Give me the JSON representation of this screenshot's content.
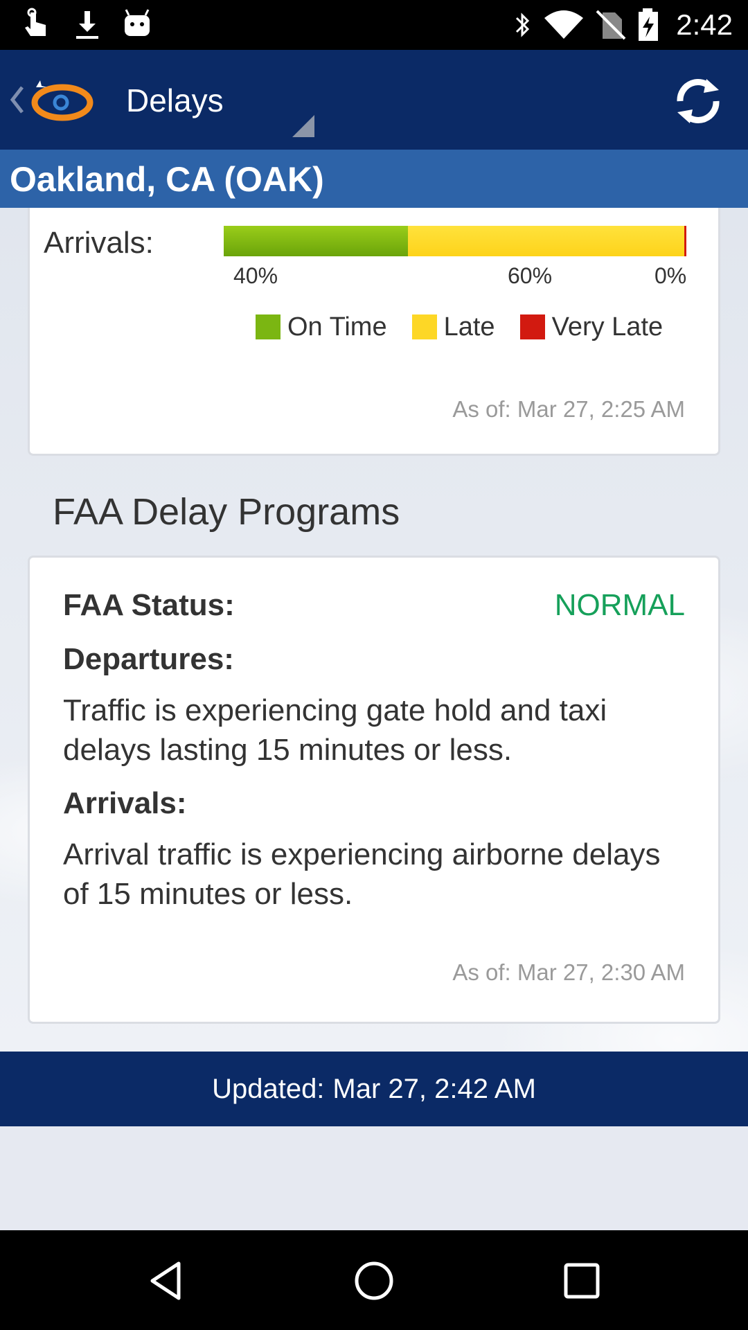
{
  "status_bar": {
    "time": "2:42",
    "left_icons": [
      "touch-icon",
      "download-icon",
      "android-icon"
    ],
    "right_icons": [
      "bluetooth-icon",
      "wifi-icon",
      "no-sim-icon",
      "battery-charging-icon"
    ]
  },
  "app_bar": {
    "title": "Delays",
    "logo": "flightview-logo",
    "refresh_icon": "refresh-icon"
  },
  "location": {
    "title": "Oakland, CA (OAK)"
  },
  "arrivals_card": {
    "label": "Arrivals:",
    "on_time_pct": 40,
    "late_pct": 60,
    "very_late_pct": 0,
    "pct_labels": [
      "40%",
      "60%",
      "0%"
    ],
    "legend": [
      "On Time",
      "Late",
      "Very Late"
    ],
    "colors": {
      "on_time": "#7bb612",
      "late": "#fdd726",
      "very_late": "#d21a10"
    },
    "as_of": "As of: Mar 27, 2:25 AM"
  },
  "faa": {
    "section_title": "FAA Delay Programs",
    "status_label": "FAA Status:",
    "status_value": "NORMAL",
    "status_color": "#16a05a",
    "departures_label": "Departures:",
    "departures_text": "Traffic is experiencing gate hold and taxi delays lasting 15 minutes or less.",
    "arrivals_label": "Arrivals:",
    "arrivals_text": "Arrival traffic is experiencing airborne delays of 15 minutes or less.",
    "as_of": "As of: Mar 27, 2:30 AM"
  },
  "footer": {
    "updated_label": "Updated:",
    "updated_value": "Mar 27, 2:42 AM"
  },
  "nav_bar": {
    "buttons": [
      "back-icon",
      "home-icon",
      "recents-icon"
    ]
  }
}
